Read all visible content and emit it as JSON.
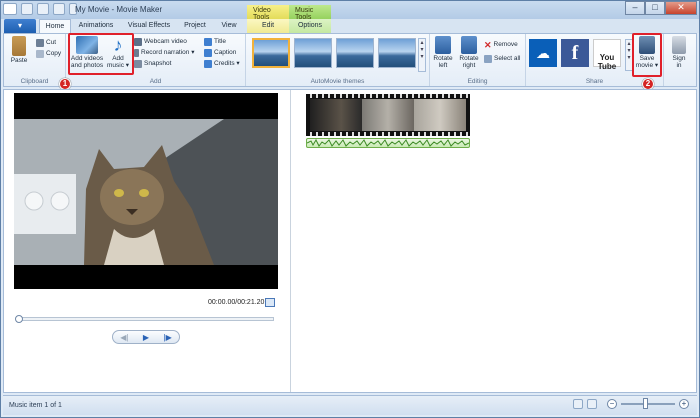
{
  "window": {
    "title": "My Movie - Movie Maker",
    "minimize": "–",
    "maximize": "□",
    "close": "✕"
  },
  "context_tabs": {
    "video_tools": "Video Tools",
    "music_tools": "Music Tools"
  },
  "tabs": [
    {
      "label": "Home"
    },
    {
      "label": "Animations"
    },
    {
      "label": "Visual Effects"
    },
    {
      "label": "Project"
    },
    {
      "label": "View"
    },
    {
      "label": "Edit"
    },
    {
      "label": "Options"
    }
  ],
  "file_button": "▾",
  "ribbon": {
    "clipboard": {
      "label": "Clipboard",
      "paste": "Paste",
      "cut": "Cut",
      "copy": "Copy"
    },
    "add": {
      "label": "Add",
      "add_videos_line1": "Add videos",
      "add_videos_line2": "and photos",
      "add_music_line1": "Add",
      "add_music_line2": "music ▾",
      "webcam": "Webcam video",
      "record": "Record narration ▾",
      "snapshot": "Snapshot",
      "title": "Title",
      "caption": "Caption",
      "credits": "Credits ▾"
    },
    "themes": {
      "label": "AutoMovie themes"
    },
    "editing": {
      "label": "Editing",
      "rotate_left_1": "Rotate",
      "rotate_left_2": "left",
      "rotate_right_1": "Rotate",
      "rotate_right_2": "right",
      "remove": "Remove",
      "select_all": "Select all"
    },
    "share": {
      "label": "Share",
      "youtube": "You\nTube",
      "facebook": "f",
      "save_movie_1": "Save",
      "save_movie_2": "movie ▾",
      "sign_in_1": "Sign",
      "sign_in_2": "in"
    }
  },
  "badges": {
    "one": "1",
    "two": "2"
  },
  "player": {
    "time": "00:00.00/00:21.20",
    "prev": "◀|",
    "play": "▶",
    "next": "|▶",
    "seek_position": 0
  },
  "status": {
    "text": "Music item 1 of 1",
    "zoom_minus": "−",
    "zoom_plus": "+"
  },
  "colors": {
    "accent": "#1e5fb0",
    "highlight": "#e0202a"
  }
}
